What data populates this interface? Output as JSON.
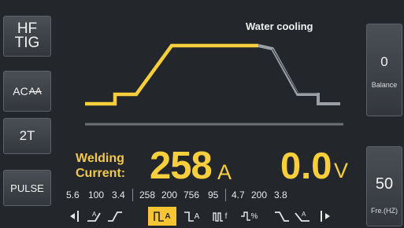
{
  "left_buttons": {
    "hf_line1": "HF",
    "hf_line2": "TIG",
    "ac_main": "AC",
    "ac_sub": "AA",
    "mode": "2T",
    "pulse": "PULSE"
  },
  "right_buttons": {
    "balance_value": "0",
    "balance_label": "Balance",
    "freq_value": "50",
    "freq_label": "Fre.(HZ)"
  },
  "header": {
    "cooling": "Water cooling"
  },
  "readout": {
    "label_line1": "Welding",
    "label_line2": "Current:",
    "current_value": "258",
    "current_unit": "A",
    "voltage_value": "0.0",
    "voltage_unit": "V"
  },
  "params": [
    "5.6",
    "100",
    "3.4",
    "258",
    "200",
    "756",
    "95",
    "4.7",
    "200",
    "3.8"
  ],
  "icon_labels": {
    "pulse_a": "A",
    "pulse_a2": "A",
    "pulse_f": "f",
    "pulse_pct": "%"
  },
  "colors": {
    "accent": "#f7cf3d",
    "panel": "#23272b",
    "curve_dim": "#9aa0a6"
  }
}
